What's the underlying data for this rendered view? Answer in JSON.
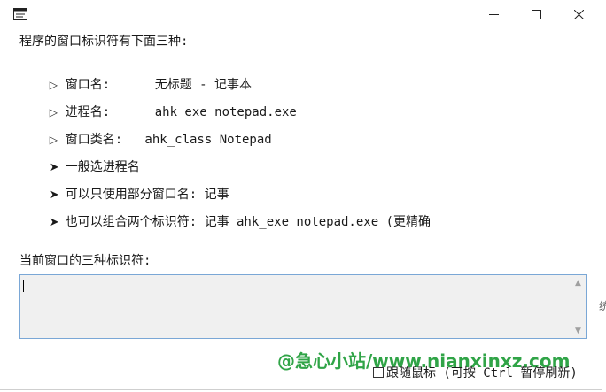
{
  "window": {
    "icon": "window-icon",
    "controls": {
      "minimize": "—",
      "maximize": "☐",
      "close": "✕"
    }
  },
  "content": {
    "intro": "程序的窗口标识符有下面三种:",
    "identifiers": [
      {
        "bullet": "▷",
        "text": "窗口名:      无标题 - 记事本"
      },
      {
        "bullet": "▷",
        "text": "进程名:      ahk_exe notepad.exe"
      },
      {
        "bullet": "▷",
        "text": "窗口类名:   ahk_class Notepad"
      }
    ],
    "tips": [
      {
        "bullet": "➤",
        "text": "一般选进程名"
      },
      {
        "bullet": "➤",
        "text": "可以只使用部分窗口名: 记事"
      },
      {
        "bullet": "➤",
        "text": "也可以组合两个标识符: 记事 ahk_exe notepad.exe (更精确"
      }
    ],
    "current_label": "当前窗口的三种标识符:",
    "textarea_value": ""
  },
  "footer": {
    "follow_mouse_label": "跟随鼠标 (可按 Ctrl 暂停刷新)",
    "follow_mouse_checked": false
  },
  "watermark": "@急心小站/www.nianxinxz.com",
  "edge_text": "统"
}
